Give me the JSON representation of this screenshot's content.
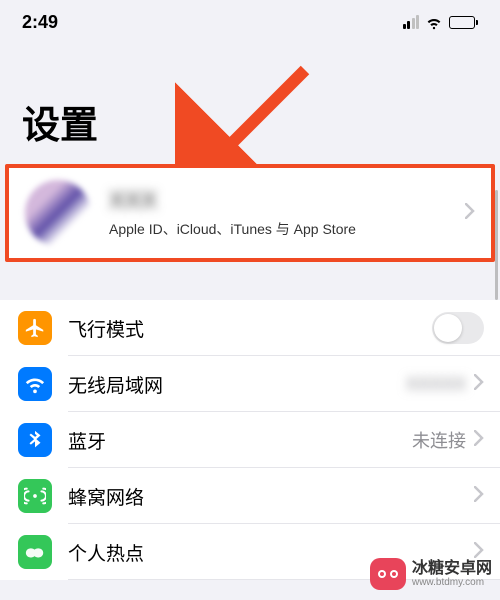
{
  "status_bar": {
    "time": "2:49"
  },
  "page_title": "设置",
  "profile": {
    "name": "XXX",
    "subtitle": "Apple ID、iCloud、iTunes 与 App Store"
  },
  "settings": {
    "airplane": {
      "label": "飞行模式",
      "on": false
    },
    "wifi": {
      "label": "无线局域网",
      "value": "XXXXX"
    },
    "bluetooth": {
      "label": "蓝牙",
      "value": "未连接"
    },
    "cellular": {
      "label": "蜂窝网络"
    },
    "hotspot": {
      "label": "个人热点"
    }
  },
  "annotation": {
    "highlight_color": "#f04a23"
  },
  "watermark": {
    "name": "冰糖安卓网",
    "url": "www.btdmy.com"
  }
}
